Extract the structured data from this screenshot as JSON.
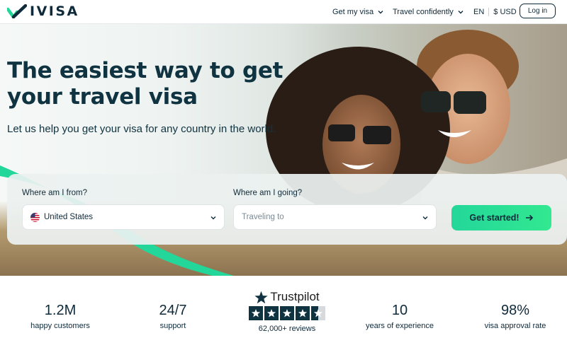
{
  "header": {
    "logo_text": "IVISA",
    "nav": [
      {
        "label": "Get my visa"
      },
      {
        "label": "Travel confidently"
      }
    ],
    "language": "EN",
    "currency": "$ USD",
    "login_label": "Log in"
  },
  "hero": {
    "headline": "The easiest way to get your travel visa",
    "subline": "Let us help you get your visa for any country in the world."
  },
  "search": {
    "from_label": "Where am I from?",
    "from_value": "United States",
    "to_label": "Where am I going?",
    "to_placeholder": "Traveling to",
    "cta_label": "Get started!"
  },
  "stats": [
    {
      "value": "1.2M",
      "label": "happy customers"
    },
    {
      "value": "24/7",
      "label": "support"
    },
    {
      "value": "10",
      "label": "years of experience"
    },
    {
      "value": "98%",
      "label": "visa approval rate"
    }
  ],
  "trustpilot": {
    "name": "Trustpilot",
    "rating": 4.5,
    "reviews": "62,000+ reviews"
  },
  "colors": {
    "brand_green": "#23d79a",
    "navy": "#0f2a3a"
  }
}
